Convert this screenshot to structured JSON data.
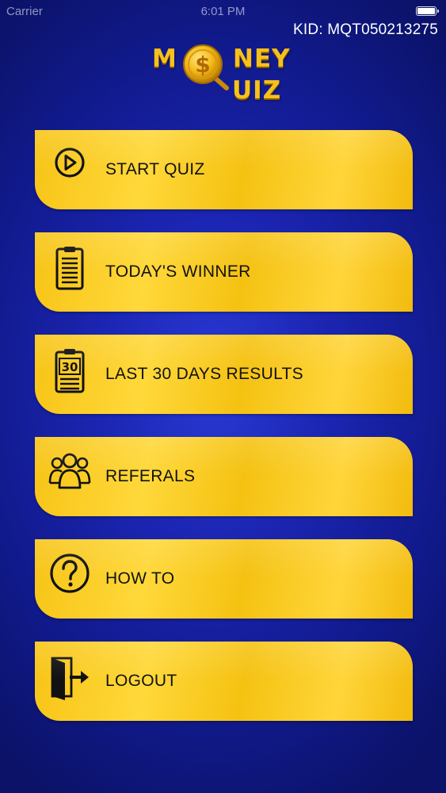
{
  "status_bar": {
    "carrier": "Carrier",
    "time": "6:01 PM"
  },
  "kid": "KID: MQT050213275",
  "logo": {
    "m": "M",
    "ney": "NEY",
    "uiz": "UIZ",
    "coin_symbol": "$"
  },
  "colors": {
    "background": "#1b25b2",
    "button": "#f7c416",
    "logo": "#f6c21a"
  },
  "menu": [
    {
      "label": "START QUIZ",
      "icon": "play-circle-icon"
    },
    {
      "label": "TODAY'S WINNER",
      "icon": "clipboard-icon"
    },
    {
      "label": "LAST 30 DAYS RESULTS",
      "icon": "calendar-30-icon",
      "icon_text": "30"
    },
    {
      "label": "REFERALS",
      "icon": "group-users-icon"
    },
    {
      "label": "HOW TO",
      "icon": "question-circle-icon"
    },
    {
      "label": "LOGOUT",
      "icon": "logout-door-icon"
    }
  ]
}
